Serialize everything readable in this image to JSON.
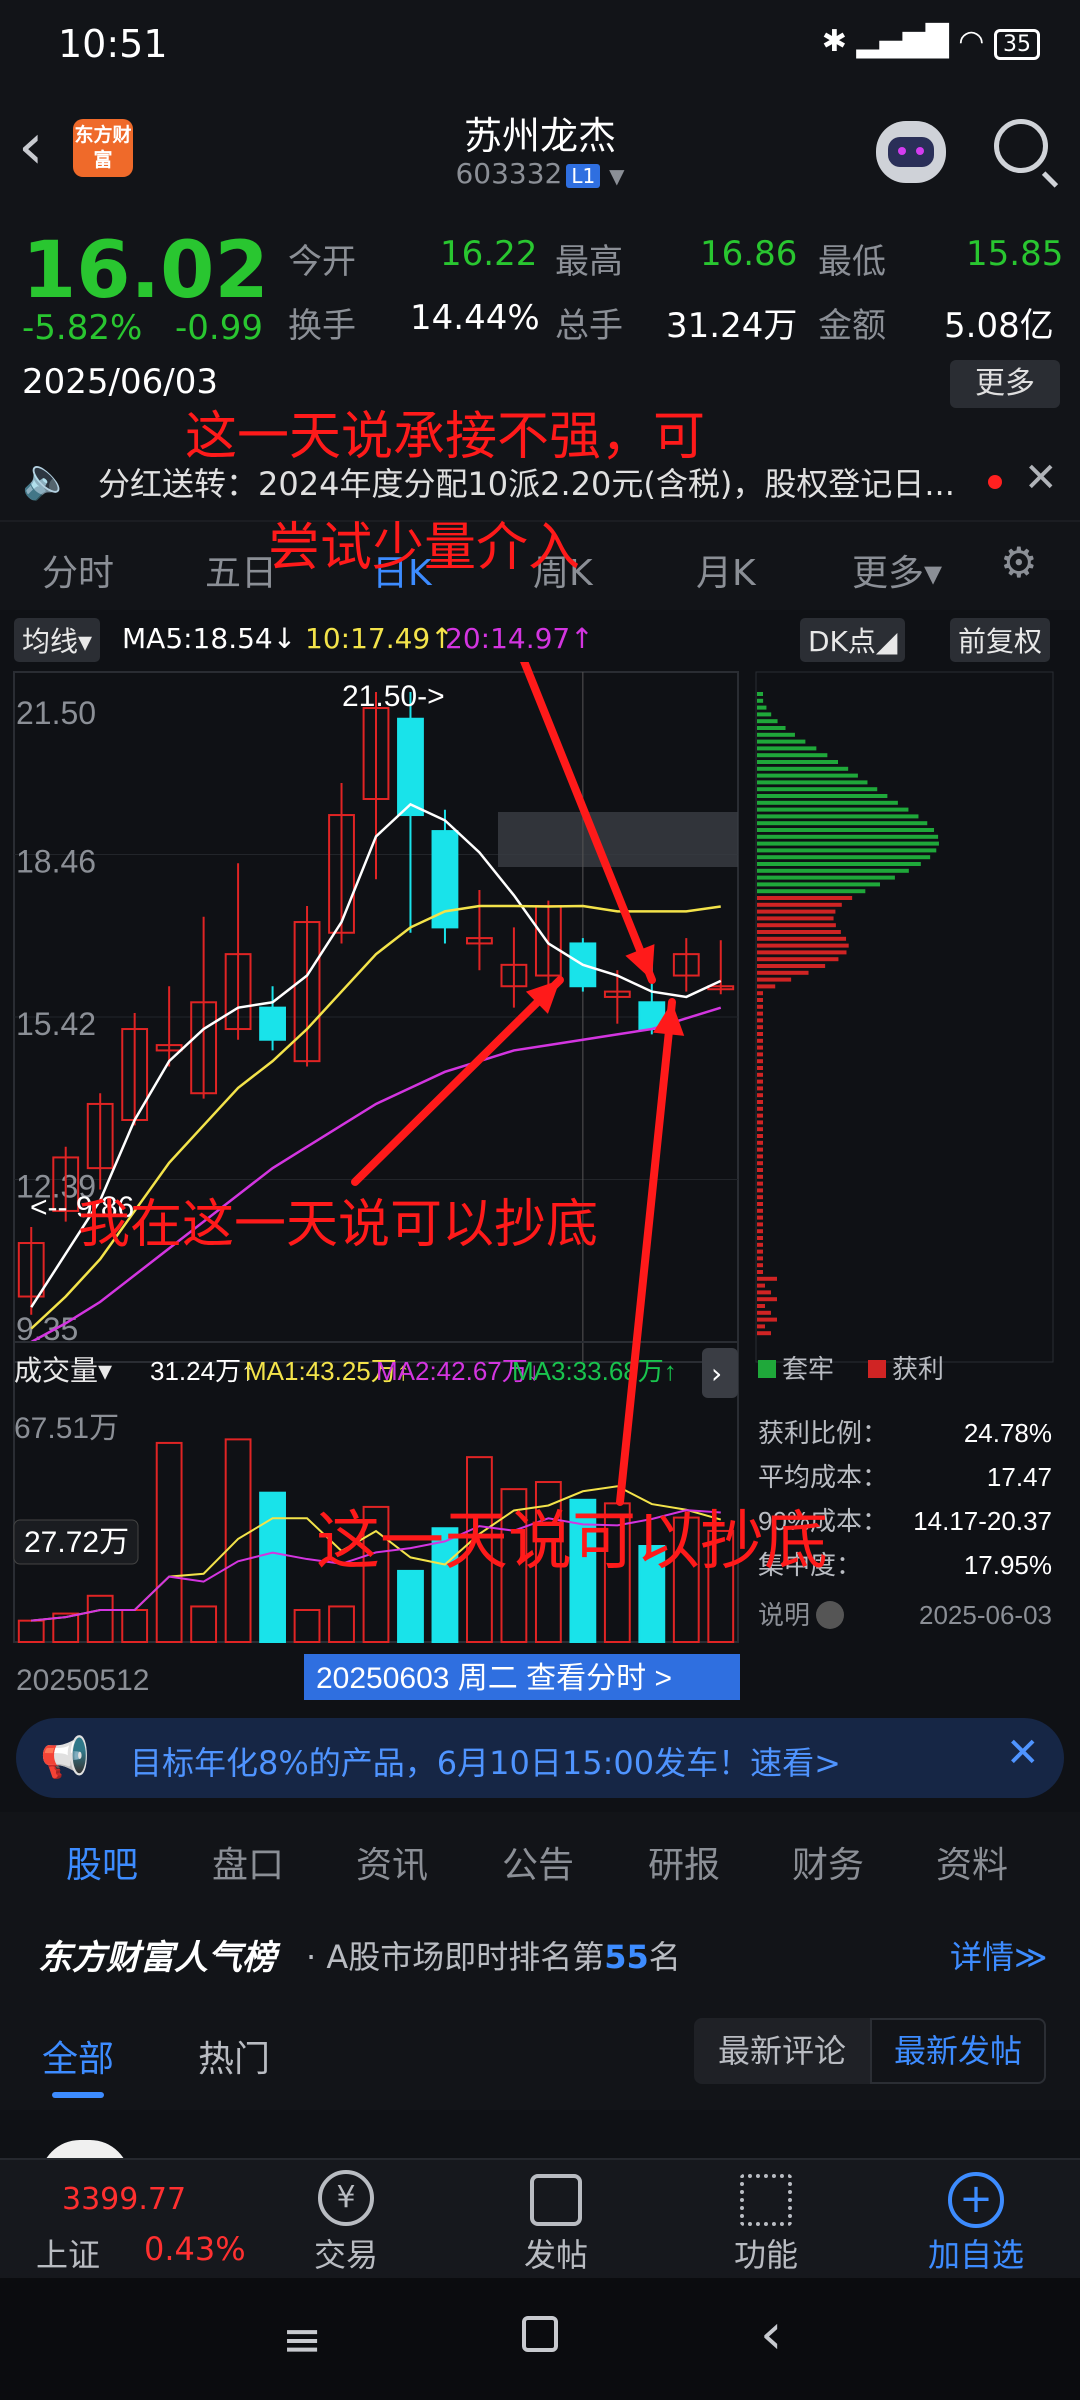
{
  "status_bar": {
    "time": "10:51",
    "battery": "35",
    "icons": [
      "bluetooth-icon",
      "signal-icon",
      "wifi-icon",
      "battery-icon"
    ]
  },
  "header": {
    "logo_text": "东方财富",
    "title": "苏州龙杰",
    "code": "603332",
    "level": "L1"
  },
  "quote": {
    "price": "16.02",
    "change_pct": "-5.82%",
    "change": "-0.99",
    "date": "2025/06/03",
    "fields": [
      {
        "label": "今开",
        "value": "16.22",
        "color": "green"
      },
      {
        "label": "最高",
        "value": "16.86",
        "color": "green"
      },
      {
        "label": "最低",
        "value": "15.85",
        "color": "green"
      },
      {
        "label": "换手",
        "value": "14.44%",
        "color": "white"
      },
      {
        "label": "总手",
        "value": "31.24万",
        "color": "white"
      },
      {
        "label": "金额",
        "value": "5.08亿",
        "color": "white"
      }
    ],
    "more": "更多"
  },
  "notice": {
    "text": "分红送转：2024年度分配10派2.20元(含税)，股权登记日..."
  },
  "tabs": [
    "分时",
    "五日",
    "日K",
    "周K",
    "月K",
    "更多▾"
  ],
  "active_tab": "日K",
  "chart_bar": {
    "ma_type": "均线▾",
    "ma5": "MA5:18.54↓",
    "ma10": "10:17.49↑",
    "ma20": "20:14.97↑",
    "dk": "DK点◢",
    "adjust": "前复权"
  },
  "price_axis": [
    "21.50",
    "18.46",
    "15.42",
    "12.39",
    "9.35"
  ],
  "high_mark": "21.50->",
  "low_mark": "<-- 9.86",
  "volume_bar": {
    "label": "成交量▾",
    "vol": "31.24万↑",
    "ma1": "MA1:43.25万↑",
    "ma2": "MA2:42.67万↓",
    "ma3": "MA3:33.68万↑"
  },
  "vol_axis": [
    "67.51万",
    "27.72万"
  ],
  "start_date": "20250512",
  "cursor_label": "20250603 周二 查看分时 >",
  "profit_panel": {
    "legend": [
      "套牢",
      "获利"
    ],
    "rows": [
      {
        "label": "获利比例：",
        "value": "24.78%"
      },
      {
        "label": "平均成本：",
        "value": "17.47"
      },
      {
        "label": "90%成本：",
        "value": "14.17-20.37"
      },
      {
        "label": "集中度：",
        "value": "17.95%"
      }
    ],
    "note_label": "说明",
    "note_date": "2025-06-03"
  },
  "annotations": {
    "a1_line1": "这一天说承接不强，可",
    "a1_line2": "尝试少量介入",
    "a2": "我在这一天说可以抄底",
    "a3": "这一天说可以抄底"
  },
  "chart_data": {
    "type": "candlestick",
    "categories": [
      "d1",
      "d2",
      "d3",
      "d4",
      "d5",
      "d6",
      "d7",
      "d8",
      "d9",
      "d10",
      "d11",
      "d12",
      "d13",
      "d14",
      "d15",
      "d16",
      "d17",
      "d18",
      "d19",
      "d20",
      "d21"
    ],
    "open": [
      10.2,
      11.8,
      12.6,
      13.5,
      14.8,
      14.0,
      15.2,
      15.6,
      14.6,
      17.0,
      19.5,
      21.0,
      18.9,
      16.8,
      16.0,
      16.2,
      16.8,
      15.8,
      15.7,
      16.2,
      16.0
    ],
    "close": [
      11.2,
      12.8,
      13.8,
      15.2,
      14.9,
      15.7,
      16.6,
      15.0,
      17.2,
      19.2,
      21.2,
      19.2,
      17.1,
      16.9,
      16.4,
      17.5,
      16.0,
      15.9,
      15.2,
      16.6,
      16.0
    ],
    "high": [
      11.5,
      13.0,
      14.0,
      15.5,
      16.0,
      17.3,
      18.3,
      16.0,
      17.5,
      19.8,
      21.5,
      21.5,
      19.3,
      17.8,
      17.1,
      17.6,
      16.9,
      16.3,
      16.4,
      16.9,
      16.86
    ],
    "low": [
      9.86,
      11.6,
      12.2,
      13.4,
      14.5,
      13.9,
      15.0,
      14.8,
      14.5,
      16.8,
      18.0,
      17.0,
      16.8,
      16.3,
      15.6,
      15.9,
      15.9,
      15.3,
      15.1,
      15.9,
      15.85
    ],
    "ylim": [
      9.35,
      21.5
    ],
    "ma_lines": [
      {
        "name": "MA5",
        "values": [
          10.0,
          11.0,
          12.0,
          13.5,
          14.6,
          15.2,
          15.6,
          15.7,
          16.2,
          17.2,
          18.8,
          19.4,
          19.1,
          18.5,
          17.7,
          16.8,
          16.4,
          16.2,
          15.9,
          15.8,
          16.1
        ]
      },
      {
        "name": "MA10",
        "values": [
          9.6,
          10.2,
          10.9,
          11.8,
          12.7,
          13.4,
          14.1,
          14.6,
          15.2,
          15.9,
          16.6,
          17.1,
          17.4,
          17.5,
          17.5,
          17.49,
          17.5,
          17.4,
          17.4,
          17.4,
          17.49
        ]
      },
      {
        "name": "MA20",
        "values": [
          9.35,
          9.7,
          10.1,
          10.6,
          11.1,
          11.6,
          12.1,
          12.6,
          13.0,
          13.4,
          13.8,
          14.1,
          14.4,
          14.6,
          14.8,
          14.9,
          15.0,
          15.1,
          15.2,
          15.4,
          15.6
        ]
      }
    ],
    "volume": [
      6,
      8,
      13,
      9,
      56,
      10,
      57,
      42,
      9,
      10,
      38,
      20,
      32,
      52,
      43,
      45,
      40,
      39,
      27,
      35,
      31.24
    ],
    "vol_ylim": [
      0,
      67.51
    ]
  }
}
